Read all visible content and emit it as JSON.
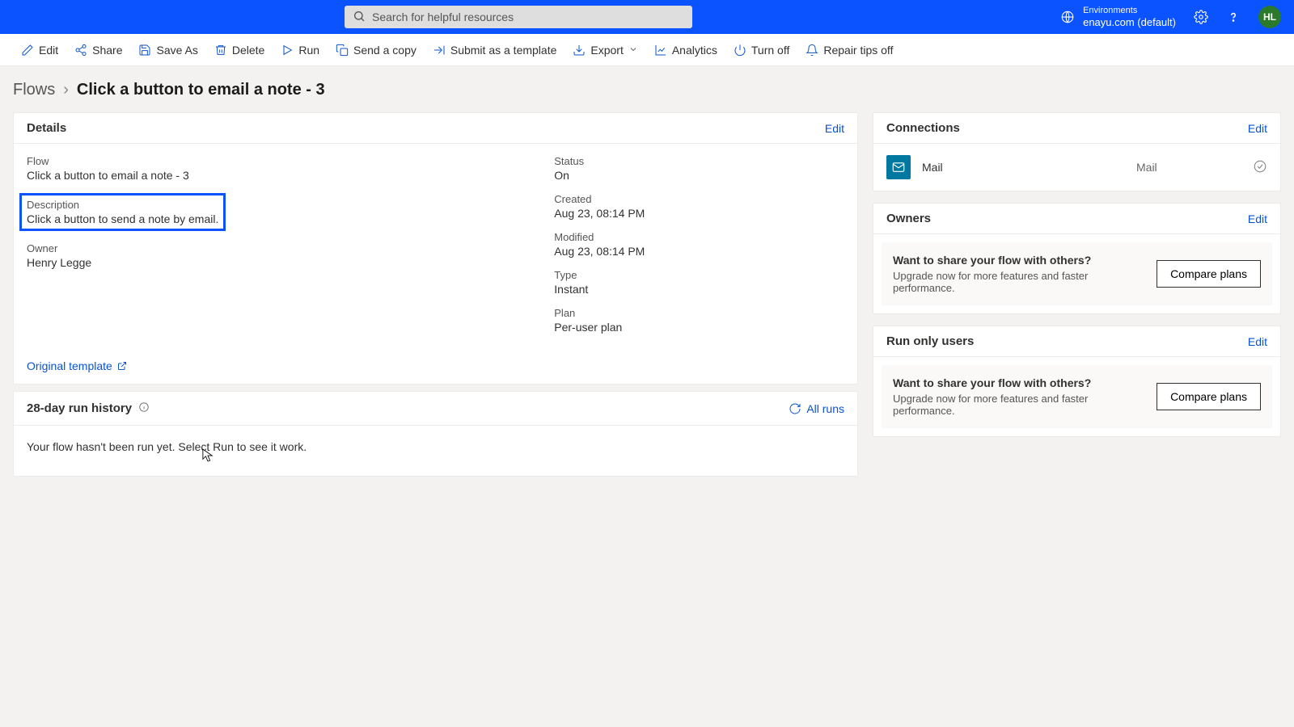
{
  "topbar": {
    "search_placeholder": "Search for helpful resources",
    "env_label": "Environments",
    "env_name": "enayu.com (default)",
    "avatar_initials": "HL"
  },
  "toolbar": {
    "edit": "Edit",
    "share": "Share",
    "save_as": "Save As",
    "delete": "Delete",
    "run": "Run",
    "send_copy": "Send a copy",
    "submit_template": "Submit as a template",
    "export": "Export",
    "analytics": "Analytics",
    "turn_off": "Turn off",
    "repair_tips_off": "Repair tips off"
  },
  "breadcrumb": {
    "root": "Flows",
    "current": "Click a button to email a note - 3"
  },
  "details": {
    "card_title": "Details",
    "edit_label": "Edit",
    "flow_label": "Flow",
    "flow_value": "Click a button to email a note - 3",
    "desc_label": "Description",
    "desc_value": "Click a button to send a note by email.",
    "owner_label": "Owner",
    "owner_value": "Henry Legge",
    "status_label": "Status",
    "status_value": "On",
    "created_label": "Created",
    "created_value": "Aug 23, 08:14 PM",
    "modified_label": "Modified",
    "modified_value": "Aug 23, 08:14 PM",
    "type_label": "Type",
    "type_value": "Instant",
    "plan_label": "Plan",
    "plan_value": "Per-user plan",
    "original_template": "Original template"
  },
  "run_history": {
    "title": "28-day run history",
    "all_runs": "All runs",
    "empty_msg": "Your flow hasn't been run yet. Select Run to see it work."
  },
  "connections": {
    "title": "Connections",
    "edit_label": "Edit",
    "item_name": "Mail",
    "item_type": "Mail"
  },
  "owners": {
    "title": "Owners",
    "edit_label": "Edit",
    "up_title": "Want to share your flow with others?",
    "up_desc": "Upgrade now for more features and faster performance.",
    "up_btn": "Compare plans"
  },
  "run_only": {
    "title": "Run only users",
    "edit_label": "Edit",
    "up_title": "Want to share your flow with others?",
    "up_desc": "Upgrade now for more features and faster performance.",
    "up_btn": "Compare plans"
  }
}
